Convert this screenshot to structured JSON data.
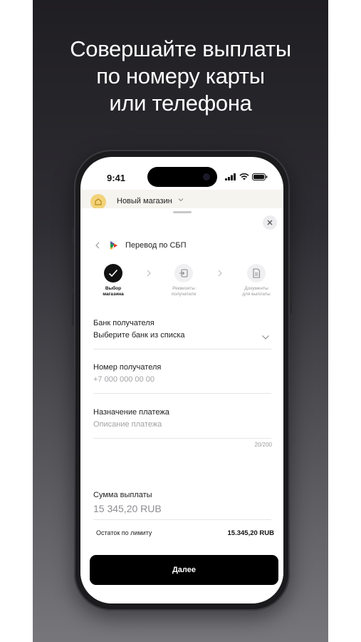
{
  "headline": {
    "line1": "Совершайте выплаты",
    "line2": "по номеру карты",
    "line3": "или телефона"
  },
  "status_bar": {
    "time": "9:41",
    "icons": [
      "signal-icon",
      "wifi-icon",
      "battery-icon"
    ]
  },
  "store": {
    "name": "Новый магазин",
    "logo_icon": "store-logo-icon"
  },
  "nav": {
    "back_icon": "chevron-left-icon",
    "logo_icon": "sbp-logo-icon",
    "title": "Перевод по СБП"
  },
  "steps": [
    {
      "label_line1": "Выбор",
      "label_line2": "магазина",
      "state": "done",
      "icon": "check-icon"
    },
    {
      "label_line1": "Реквизиты",
      "label_line2": "получателя",
      "state": "pending",
      "icon": "login-icon"
    },
    {
      "label_line1": "Документы",
      "label_line2": "для выплаты",
      "state": "pending",
      "icon": "document-icon"
    }
  ],
  "form": {
    "bank": {
      "label": "Банк получателя",
      "value": "Выберите банк из списка"
    },
    "recipient": {
      "label": "Номер получателя",
      "placeholder": "+7 000 000 00 00"
    },
    "purpose": {
      "label": "Назначение платежа",
      "placeholder": "Описание платежа",
      "counter": "20/200"
    },
    "amount": {
      "label": "Сумма выплаты",
      "value": "15 345,20 RUB"
    }
  },
  "limit": {
    "label": "Остаток по лимиту",
    "value": "15.345,20 RUB"
  },
  "next_button": {
    "label": "Далее"
  },
  "colors": {
    "accent": "#000000",
    "store_logo": "#f2d37a",
    "muted_text": "#a2a2a6"
  }
}
